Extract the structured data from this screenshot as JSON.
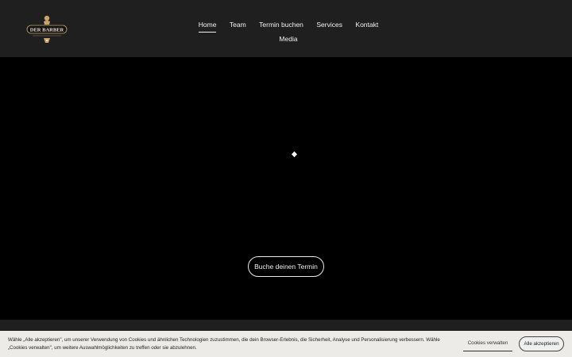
{
  "header": {
    "logo_text": "DER BARBER",
    "nav": [
      {
        "label": "Home",
        "active": true
      },
      {
        "label": "Team"
      },
      {
        "label": "Termin buchen"
      },
      {
        "label": "Services"
      },
      {
        "label": "Kontakt"
      },
      {
        "label": "Media"
      }
    ]
  },
  "hero": {
    "cta_label": "Buche deinen Termin"
  },
  "cookie_banner": {
    "text": "Wähle „Alle akzeptieren\", um unserer Verwendung von Cookies und ähnlichen Technologien zuzustimmen, die dein Browser-Erlebnis, die Sicherheit, Analyse und Personalisierung verbessern. Wähle „Cookies verwalten\", um weitere Auswahlmöglichkeiten zu treffen oder sie abzulehnen.",
    "manage_label": "Cookies verwalten",
    "accept_label": "Alle akzeptieren"
  },
  "colors": {
    "header_bg": "#1f1f1f",
    "hero_bg": "#000000",
    "banner_bg": "#ecebe7"
  }
}
